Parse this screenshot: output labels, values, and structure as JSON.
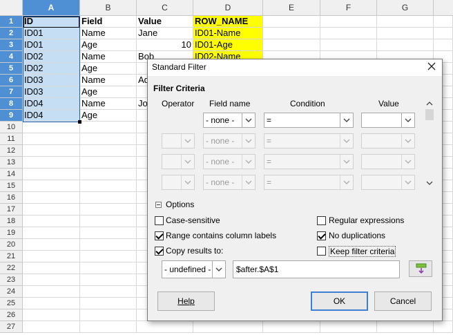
{
  "sheet": {
    "columns": [
      "A",
      "B",
      "C",
      "D",
      "E",
      "F",
      "G"
    ],
    "rows": [
      "1",
      "2",
      "3",
      "4",
      "5",
      "6",
      "7",
      "8",
      "9",
      "10",
      "11",
      "12",
      "13",
      "14",
      "15",
      "16",
      "17",
      "18",
      "19",
      "20",
      "21",
      "22",
      "23",
      "24",
      "25",
      "26",
      "27"
    ],
    "cells": {
      "A": [
        "ID",
        "ID01",
        "ID01",
        "ID02",
        "ID02",
        "ID03",
        "ID03",
        "ID04",
        "ID04"
      ],
      "B": [
        "Field",
        "Name",
        "Age",
        "Name",
        "Age",
        "Name",
        "Age",
        "Name",
        "Age"
      ],
      "C": [
        "Value",
        "Jane",
        "10",
        "Bob",
        "",
        "Ad",
        "",
        "Jo",
        ""
      ],
      "D": [
        "ROW_NAME",
        "ID01-Name",
        "ID01-Age",
        "ID02-Name"
      ]
    },
    "colors": {
      "selection_header": "#4f8fd4",
      "selection_fill": "#c6def4",
      "highlight": "#ffff00"
    }
  },
  "dialog": {
    "title": "Standard Filter",
    "close_icon": "close-icon",
    "filter_criteria_label": "Filter Criteria",
    "headers": {
      "operator": "Operator",
      "field_name": "Field name",
      "condition": "Condition",
      "value": "Value"
    },
    "criteria_rows": [
      {
        "operator": "",
        "field": "- none -",
        "condition": "=",
        "value": "",
        "enabled": true
      },
      {
        "operator": "",
        "field": "- none -",
        "condition": "=",
        "value": "",
        "enabled": false
      },
      {
        "operator": "",
        "field": "- none -",
        "condition": "=",
        "value": "",
        "enabled": false
      },
      {
        "operator": "",
        "field": "- none -",
        "condition": "=",
        "value": "",
        "enabled": false
      }
    ],
    "options_label": "Options",
    "options": {
      "case_sensitive": {
        "label": "Case-sensitive",
        "checked": false
      },
      "range_labels": {
        "label": "Range contains column labels",
        "checked": true
      },
      "copy_results": {
        "label": "Copy results to:",
        "checked": true
      },
      "regex": {
        "label": "Regular expressions",
        "checked": false
      },
      "no_dup": {
        "label": "No duplications",
        "checked": true
      },
      "keep_criteria": {
        "label": "Keep filter criteria",
        "checked": false
      }
    },
    "copy_target_select": "- undefined -",
    "copy_target_value": "$after.$A$1",
    "buttons": {
      "help": "Help",
      "ok": "OK",
      "cancel": "Cancel"
    }
  }
}
